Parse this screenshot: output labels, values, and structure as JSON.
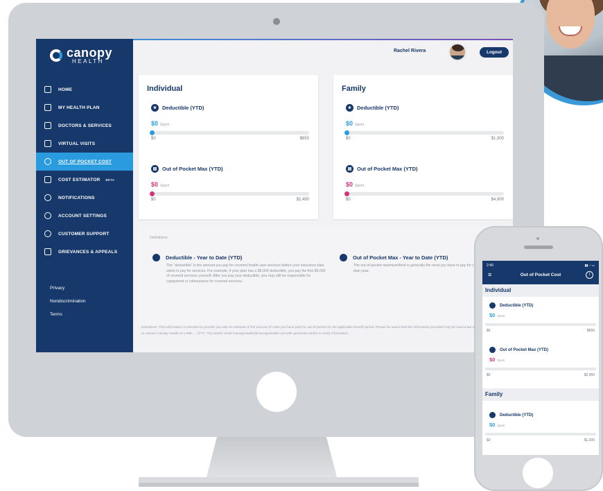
{
  "brand": {
    "name": "canopy",
    "sub": "HEALTH",
    "accent": "#2b9be0",
    "navy": "#17386a",
    "pink": "#d1347a"
  },
  "sidebar": {
    "items": [
      {
        "label": "HOME",
        "icon": "home-icon"
      },
      {
        "label": "MY HEALTH PLAN",
        "icon": "plan-icon"
      },
      {
        "label": "DOCTORS & SERVICES",
        "icon": "doctor-icon"
      },
      {
        "label": "VIRTUAL VISITS",
        "icon": "video-icon"
      },
      {
        "label": "OUT OF POCKET COST",
        "icon": "cost-icon",
        "active": true
      },
      {
        "label": "COST ESTIMATOR",
        "icon": "calculator-icon",
        "badge": "BETA"
      },
      {
        "label": "NOTIFICATIONS",
        "icon": "bell-icon"
      },
      {
        "label": "ACCOUNT SETTINGS",
        "icon": "gear-icon"
      },
      {
        "label": "CUSTOMER SUPPORT",
        "icon": "support-icon"
      },
      {
        "label": "GRIEVANCES & APPEALS",
        "icon": "document-icon"
      }
    ],
    "footer": [
      "Privacy",
      "Nondiscrimination",
      "Terms"
    ]
  },
  "header": {
    "user_name": "Rachel Rivera",
    "logout_label": "Logout"
  },
  "individual": {
    "title": "Individual",
    "deductible": {
      "label": "Deductible (YTD)",
      "spent": "$0",
      "spent_suffix": "Spent",
      "min": "$0",
      "max": "$650",
      "progress": 0
    },
    "oop": {
      "label": "Out of Pocket Max (YTD)",
      "spent": "$0",
      "spent_suffix": "Spent",
      "min": "$0",
      "max": "$2,450",
      "progress": 0
    }
  },
  "family": {
    "title": "Family",
    "deductible": {
      "label": "Deductible (YTD)",
      "spent": "$0",
      "spent_suffix": "Spent",
      "min": "$0",
      "max": "$1,300",
      "progress": 0
    },
    "oop": {
      "label": "Out of Pocket Max (YTD)",
      "spent": "$0",
      "spent_suffix": "Spent",
      "min": "$0",
      "max": "$4,900",
      "progress": 0
    }
  },
  "definitions": {
    "title": "Definitions",
    "deductible": {
      "title": "Deductible - Year to Date (YTD)",
      "text": "The “deductible” is the amount you pay for covered health care services before your insurance plan starts to pay for services. For example, if your plan has a $5,000 deductible, you pay the first $5,000 of covered services yourself. After you pay your deductible, you may still be responsible for copayment or coinsurance for covered services."
    },
    "oop": {
      "title": "Out of Pocket Max - Year to Date (YTD)",
      "text": "The out-of-pocket maximum/limit is generally the most you have to pay for covered services within a plan year."
    }
  },
  "disclaimer": "Disclaimer: This information is intended to provide you with an estimate of the amount of costs you have paid for out-of-pocket for the applicable benefit period. Please be aware that the information provided may be inaccurate and you are encouraged to contact Canopy Health at 1-888-… (TTY: 711) and/or email CanopyHealth@CanopyHealth.com with questions and/or to verify information.",
  "phone": {
    "time": "2:40",
    "title": "Out of Pocket Cost",
    "individual_title": "Individual",
    "family_title": "Family",
    "deductible_label": "Deductible (YTD)",
    "oop_label": "Out of Pocket Max (YTD)",
    "spent": "$0",
    "spent_suffix": "Spent",
    "ind_ded_min": "$0",
    "ind_ded_max": "$650",
    "ind_oop_min": "$0",
    "ind_oop_max": "$2,450",
    "fam_ded_min": "$0",
    "fam_ded_max": "$1,300"
  }
}
